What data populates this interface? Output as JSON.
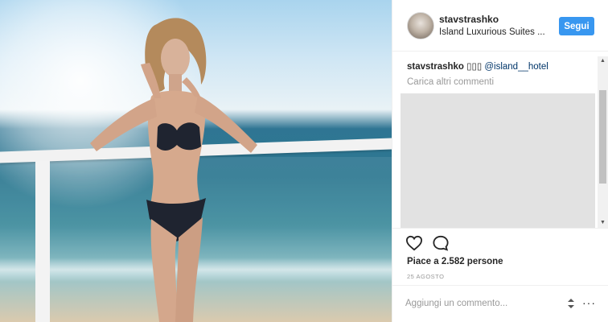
{
  "post": {
    "username": "stavstrashko",
    "location": "Island Luxurious Suites ...",
    "follow_label": "Segui",
    "caption": {
      "username": "stavstrashko",
      "text": " ▯▯▯ ",
      "mention": "@island__hotel"
    },
    "load_more": "Carica altri commenti",
    "likes": "Piace a 2.582 persone",
    "date": "25 AGOSTO",
    "comment_placeholder": "Aggiungi un commento...",
    "more_label": "···"
  },
  "icons": {
    "like": "heart-icon",
    "comment": "comment-bubble-icon",
    "more": "more-options-icon"
  },
  "colors": {
    "follow_button": "#3897f0",
    "mention": "#003569"
  }
}
